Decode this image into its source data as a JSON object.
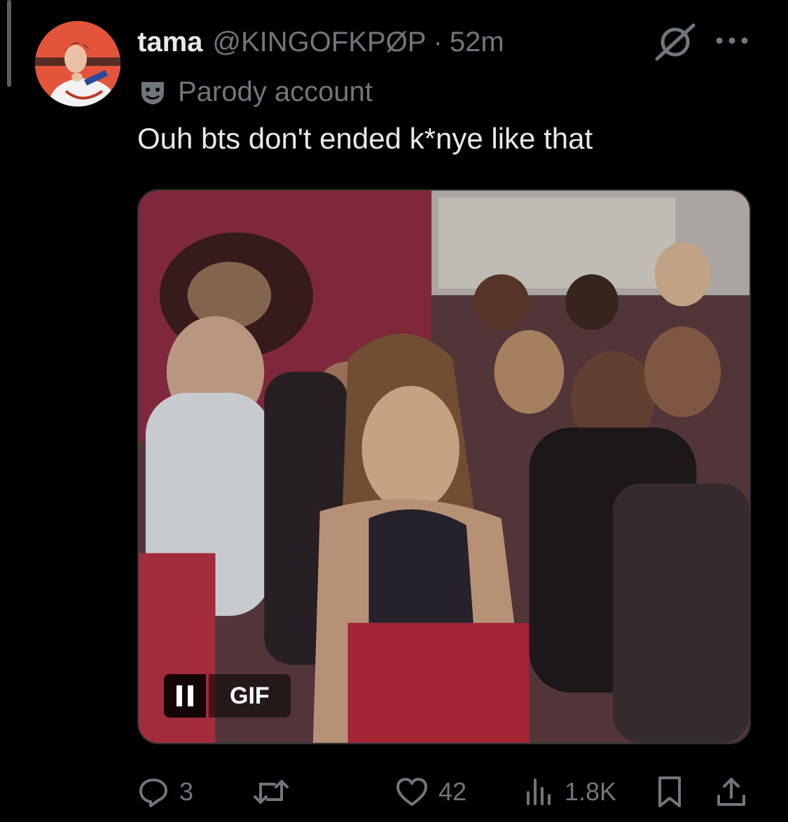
{
  "tweet": {
    "display_name": "tama",
    "handle": "@KINGOFKPØP",
    "separator": "·",
    "time": "52m",
    "label": "Parody account",
    "text": "Ouh bts don't ended k*nye like that"
  },
  "media": {
    "type": "gif",
    "badge": "GIF",
    "playing": true
  },
  "actions": {
    "replies": "3",
    "reposts": "",
    "likes": "42",
    "views": "1.8K"
  },
  "icons": {
    "grok": "grok-icon",
    "more": "more-icon",
    "parody": "parody-mask-icon",
    "reply": "reply-icon",
    "repost": "repost-icon",
    "like": "heart-icon",
    "views": "views-icon",
    "bookmark": "bookmark-icon",
    "share": "share-icon",
    "pause": "pause-icon"
  },
  "colors": {
    "background": "#000000",
    "text_primary": "#e7e9ea",
    "text_secondary": "#71767b",
    "border": "#2f3336"
  }
}
